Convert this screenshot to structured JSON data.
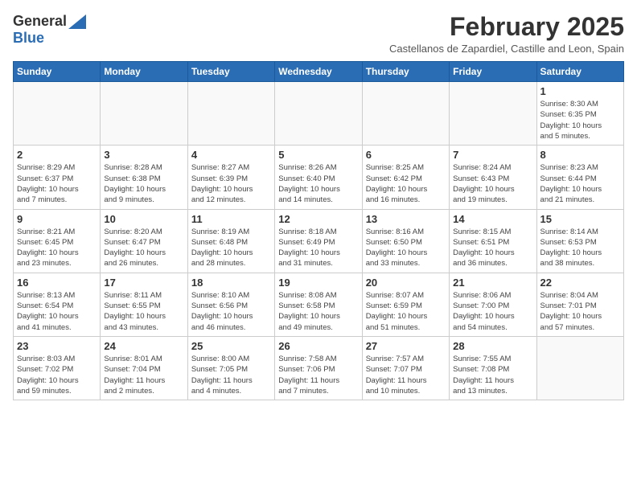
{
  "logo": {
    "general": "General",
    "blue": "Blue"
  },
  "title": "February 2025",
  "subtitle": "Castellanos de Zapardiel, Castille and Leon, Spain",
  "days_of_week": [
    "Sunday",
    "Monday",
    "Tuesday",
    "Wednesday",
    "Thursday",
    "Friday",
    "Saturday"
  ],
  "weeks": [
    [
      {
        "day": "",
        "info": ""
      },
      {
        "day": "",
        "info": ""
      },
      {
        "day": "",
        "info": ""
      },
      {
        "day": "",
        "info": ""
      },
      {
        "day": "",
        "info": ""
      },
      {
        "day": "",
        "info": ""
      },
      {
        "day": "1",
        "info": "Sunrise: 8:30 AM\nSunset: 6:35 PM\nDaylight: 10 hours\nand 5 minutes."
      }
    ],
    [
      {
        "day": "2",
        "info": "Sunrise: 8:29 AM\nSunset: 6:37 PM\nDaylight: 10 hours\nand 7 minutes."
      },
      {
        "day": "3",
        "info": "Sunrise: 8:28 AM\nSunset: 6:38 PM\nDaylight: 10 hours\nand 9 minutes."
      },
      {
        "day": "4",
        "info": "Sunrise: 8:27 AM\nSunset: 6:39 PM\nDaylight: 10 hours\nand 12 minutes."
      },
      {
        "day": "5",
        "info": "Sunrise: 8:26 AM\nSunset: 6:40 PM\nDaylight: 10 hours\nand 14 minutes."
      },
      {
        "day": "6",
        "info": "Sunrise: 8:25 AM\nSunset: 6:42 PM\nDaylight: 10 hours\nand 16 minutes."
      },
      {
        "day": "7",
        "info": "Sunrise: 8:24 AM\nSunset: 6:43 PM\nDaylight: 10 hours\nand 19 minutes."
      },
      {
        "day": "8",
        "info": "Sunrise: 8:23 AM\nSunset: 6:44 PM\nDaylight: 10 hours\nand 21 minutes."
      }
    ],
    [
      {
        "day": "9",
        "info": "Sunrise: 8:21 AM\nSunset: 6:45 PM\nDaylight: 10 hours\nand 23 minutes."
      },
      {
        "day": "10",
        "info": "Sunrise: 8:20 AM\nSunset: 6:47 PM\nDaylight: 10 hours\nand 26 minutes."
      },
      {
        "day": "11",
        "info": "Sunrise: 8:19 AM\nSunset: 6:48 PM\nDaylight: 10 hours\nand 28 minutes."
      },
      {
        "day": "12",
        "info": "Sunrise: 8:18 AM\nSunset: 6:49 PM\nDaylight: 10 hours\nand 31 minutes."
      },
      {
        "day": "13",
        "info": "Sunrise: 8:16 AM\nSunset: 6:50 PM\nDaylight: 10 hours\nand 33 minutes."
      },
      {
        "day": "14",
        "info": "Sunrise: 8:15 AM\nSunset: 6:51 PM\nDaylight: 10 hours\nand 36 minutes."
      },
      {
        "day": "15",
        "info": "Sunrise: 8:14 AM\nSunset: 6:53 PM\nDaylight: 10 hours\nand 38 minutes."
      }
    ],
    [
      {
        "day": "16",
        "info": "Sunrise: 8:13 AM\nSunset: 6:54 PM\nDaylight: 10 hours\nand 41 minutes."
      },
      {
        "day": "17",
        "info": "Sunrise: 8:11 AM\nSunset: 6:55 PM\nDaylight: 10 hours\nand 43 minutes."
      },
      {
        "day": "18",
        "info": "Sunrise: 8:10 AM\nSunset: 6:56 PM\nDaylight: 10 hours\nand 46 minutes."
      },
      {
        "day": "19",
        "info": "Sunrise: 8:08 AM\nSunset: 6:58 PM\nDaylight: 10 hours\nand 49 minutes."
      },
      {
        "day": "20",
        "info": "Sunrise: 8:07 AM\nSunset: 6:59 PM\nDaylight: 10 hours\nand 51 minutes."
      },
      {
        "day": "21",
        "info": "Sunrise: 8:06 AM\nSunset: 7:00 PM\nDaylight: 10 hours\nand 54 minutes."
      },
      {
        "day": "22",
        "info": "Sunrise: 8:04 AM\nSunset: 7:01 PM\nDaylight: 10 hours\nand 57 minutes."
      }
    ],
    [
      {
        "day": "23",
        "info": "Sunrise: 8:03 AM\nSunset: 7:02 PM\nDaylight: 10 hours\nand 59 minutes."
      },
      {
        "day": "24",
        "info": "Sunrise: 8:01 AM\nSunset: 7:04 PM\nDaylight: 11 hours\nand 2 minutes."
      },
      {
        "day": "25",
        "info": "Sunrise: 8:00 AM\nSunset: 7:05 PM\nDaylight: 11 hours\nand 4 minutes."
      },
      {
        "day": "26",
        "info": "Sunrise: 7:58 AM\nSunset: 7:06 PM\nDaylight: 11 hours\nand 7 minutes."
      },
      {
        "day": "27",
        "info": "Sunrise: 7:57 AM\nSunset: 7:07 PM\nDaylight: 11 hours\nand 10 minutes."
      },
      {
        "day": "28",
        "info": "Sunrise: 7:55 AM\nSunset: 7:08 PM\nDaylight: 11 hours\nand 13 minutes."
      },
      {
        "day": "",
        "info": ""
      }
    ]
  ]
}
